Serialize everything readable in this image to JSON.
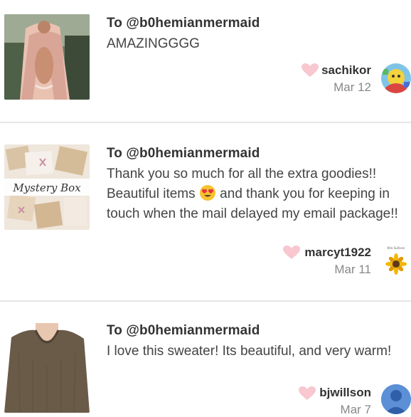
{
  "messages": [
    {
      "to": "To @b0hemianmermaid",
      "body": "AMAZINGGGG",
      "username": "sachikor",
      "date": "Mar 12",
      "thumb": "pink-robe-photo",
      "avatar": "colorful-avatar"
    },
    {
      "to": "To @b0hemianmermaid",
      "body_before_emoji": "Thank you so much for all the extra goodies!! Beautiful items",
      "emoji": "heart-eyes-emoji",
      "body_after_emoji": " and thank you for keeping in touch when the mail delayed my email package!!",
      "username": "marcyt1922",
      "date": "Mar 11",
      "thumb_caption": "Mystery Box",
      "avatar_caption": "Kite Sullivan",
      "avatar": "sunflower-avatar"
    },
    {
      "to": "To @b0hemianmermaid",
      "body": "I love this sweater! Its beautiful, and very warm!",
      "username": "bjwillson",
      "date": "Mar 7",
      "thumb": "brown-sweater-photo",
      "avatar": "default-user-avatar"
    }
  ],
  "colors": {
    "heart": "#f8c7cf",
    "text": "#333333",
    "muted": "#888888",
    "divider": "#e6e6e6",
    "default_avatar": "#5b8fd6"
  }
}
